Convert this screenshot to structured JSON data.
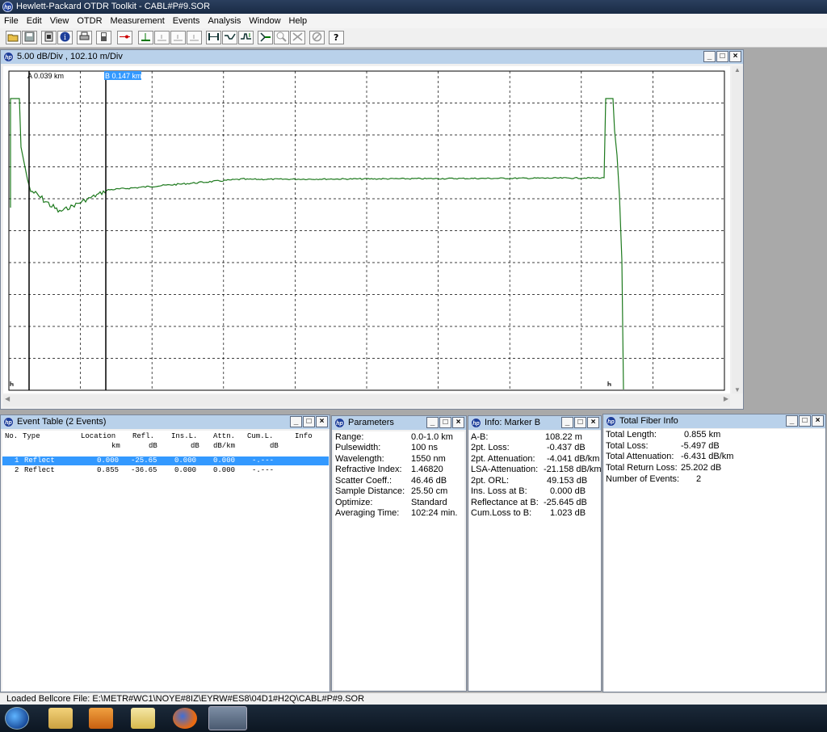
{
  "app": {
    "title": "Hewlett-Packard OTDR Toolkit - CABL#P#9.SOR",
    "icon_name": "hp-logo-icon"
  },
  "menu": [
    "File",
    "Edit",
    "View",
    "OTDR",
    "Measurement",
    "Events",
    "Analysis",
    "Window",
    "Help"
  ],
  "toolbar": {
    "buttons": [
      "open-icon",
      "save-icon",
      "clipboard-icon",
      "info-icon",
      "print-icon",
      "device-icon",
      "laser-icon",
      "marker-a-icon",
      "marker-b-icon",
      "marker-c-icon",
      "marker-d-icon",
      "span-icon",
      "trace-icon",
      "trace-peak-icon",
      "zoom-fit-icon",
      "zoom-icon",
      "zoom-cancel-icon",
      "stop-icon",
      "help-icon"
    ]
  },
  "trace_window": {
    "title": "5.00 dB/Div ,  102.10 m/Div",
    "marker_a_label": "A 0.039 km",
    "marker_b_label": "B 0.147 km",
    "marker_a_km": 0.039,
    "marker_b_km": 0.147,
    "trace_color": "#1e7a1e"
  },
  "event_table": {
    "title": "Event Table (2 Events)",
    "headers": [
      "No.",
      "Type",
      "Location",
      "Refl.",
      "Ins.L.",
      "Attn.",
      "Cum.L.",
      "Info"
    ],
    "units": [
      "km",
      "dB",
      "dB",
      "dB/km",
      "dB"
    ],
    "rows": [
      [
        "1",
        "Reflect",
        "0.000",
        "-25.65",
        "0.000",
        "0.000",
        "-.---"
      ],
      [
        "2",
        "Reflect",
        "0.855",
        "-36.65",
        "0.000",
        "0.000",
        "-.---"
      ]
    ]
  },
  "parameters": {
    "title": "Parameters",
    "items": [
      [
        "Range:",
        "0.0-1.0 km"
      ],
      [
        "Pulsewidth:",
        "100 ns"
      ],
      [
        "Wavelength:",
        "1550 nm"
      ],
      [
        "Refractive Index:",
        "1.46820"
      ],
      [
        "Scatter Coeff.:",
        "46.46 dB"
      ],
      [
        "Sample Distance:",
        "25.50 cm"
      ],
      [
        "Optimize:",
        "Standard"
      ],
      [
        "Averaging Time:",
        "102:24 min."
      ]
    ]
  },
  "marker_info": {
    "title": "Info: Marker B",
    "items": [
      [
        "A-B:",
        "108.22 m"
      ],
      [
        "2pt. Loss:",
        "-0.437 dB"
      ],
      [
        "2pt. Attenuation:",
        "-4.041 dB/km"
      ],
      [
        "LSA-Attenuation:",
        "-21.158 dB/km"
      ],
      [
        "2pt. ORL:",
        "49.153 dB"
      ],
      [
        "Ins. Loss at B:",
        "0.000 dB"
      ],
      [
        "Reflectance at B:",
        "-25.645 dB"
      ],
      [
        "Cum.Loss to B:",
        "1.023 dB"
      ]
    ]
  },
  "fiber_info": {
    "title": "Total Fiber Info",
    "items": [
      [
        "Total Length:",
        "0.855 km"
      ],
      [
        "Total Loss:",
        "-5.497 dB"
      ],
      [
        "Total Attenuation:",
        "-6.431 dB/km"
      ],
      [
        "Total Return Loss:",
        "25.202 dB"
      ],
      [
        "Number of Events:",
        "2"
      ]
    ]
  },
  "status": {
    "text": "Loaded Bellcore File:  E:\\METR#WC1\\NOYE#8IZ\\EYRW#ES8\\04D1#H2Q\\CABL#P#9.SOR"
  },
  "taskbar": {
    "items": [
      "start-orb-icon",
      "explorer-icon",
      "media-player-icon",
      "mail-icon",
      "firefox-icon",
      "otdr-toolkit-icon"
    ]
  }
}
